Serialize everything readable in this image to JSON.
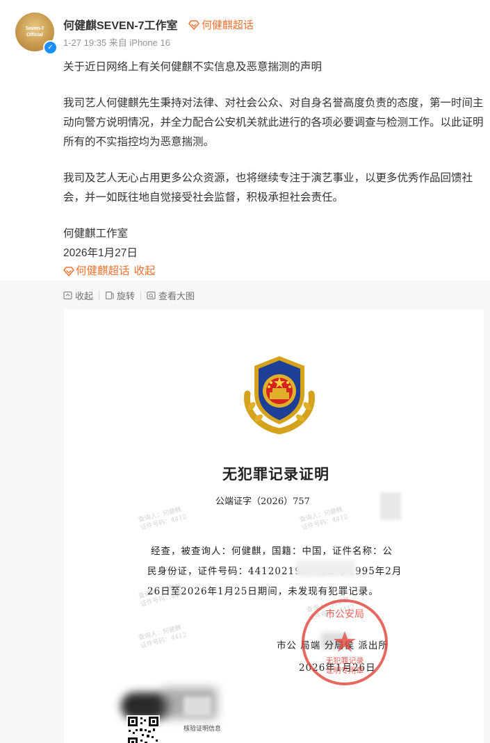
{
  "post": {
    "username": "何健麒SEVEN-7工作室",
    "supertopic_link": "何健麒超话",
    "meta": "1-27 19:35 来自 iPhone 16",
    "avatar_text": [
      "Seven-7",
      "Official"
    ],
    "paragraphs": [
      "关于近日网络上有关何健麒不实信息及恶意揣测的声明",
      "我司艺人何健麒先生秉持对法律、对社会公众、对自身名誉高度负责的态度，第一时间主动向警方说明情况，并全力配合公安机关就此进行的各项必要调查与检测工作。以此证明所有的不实指控均为恶意揣测。",
      "我司及艺人无心占用更多公众资源，也将继续专注于演艺事业，以更多优秀作品回馈社会，并一如既往地自觉接受社会监督，积极承担社会责任。",
      "何健麒工作室",
      "2026年1月27日"
    ],
    "bottom_supertopic": "何健麒超话",
    "fold_label": "收起"
  },
  "media_toolbar": {
    "collapse": "收起",
    "rotate": "旋转",
    "view_large": "查看大图"
  },
  "document": {
    "title": "无犯罪记录证明",
    "number": "公端证字（2026）757",
    "lines": [
      "经查，被查询人：何健麒，国籍：中国，证件名称：公",
      "民身份证，证件号码：4412021995022          于1995年2月",
      "26日至2026年1月25日期间，未发现有犯罪记录。"
    ],
    "office": "市公   局端   分局侯   派出所",
    "date": "2026年1月26日",
    "stamp_top": "市公安局",
    "stamp_lines": [
      "无犯罪记录",
      "证明专用章"
    ],
    "qr_label": "核验证明信息",
    "watermark_text": "查询人：何健麒",
    "watermark_sub": "证件号码：4412"
  },
  "colors": {
    "accent": "#f2712e",
    "meta": "#939393",
    "stamp": "#e0443a"
  }
}
